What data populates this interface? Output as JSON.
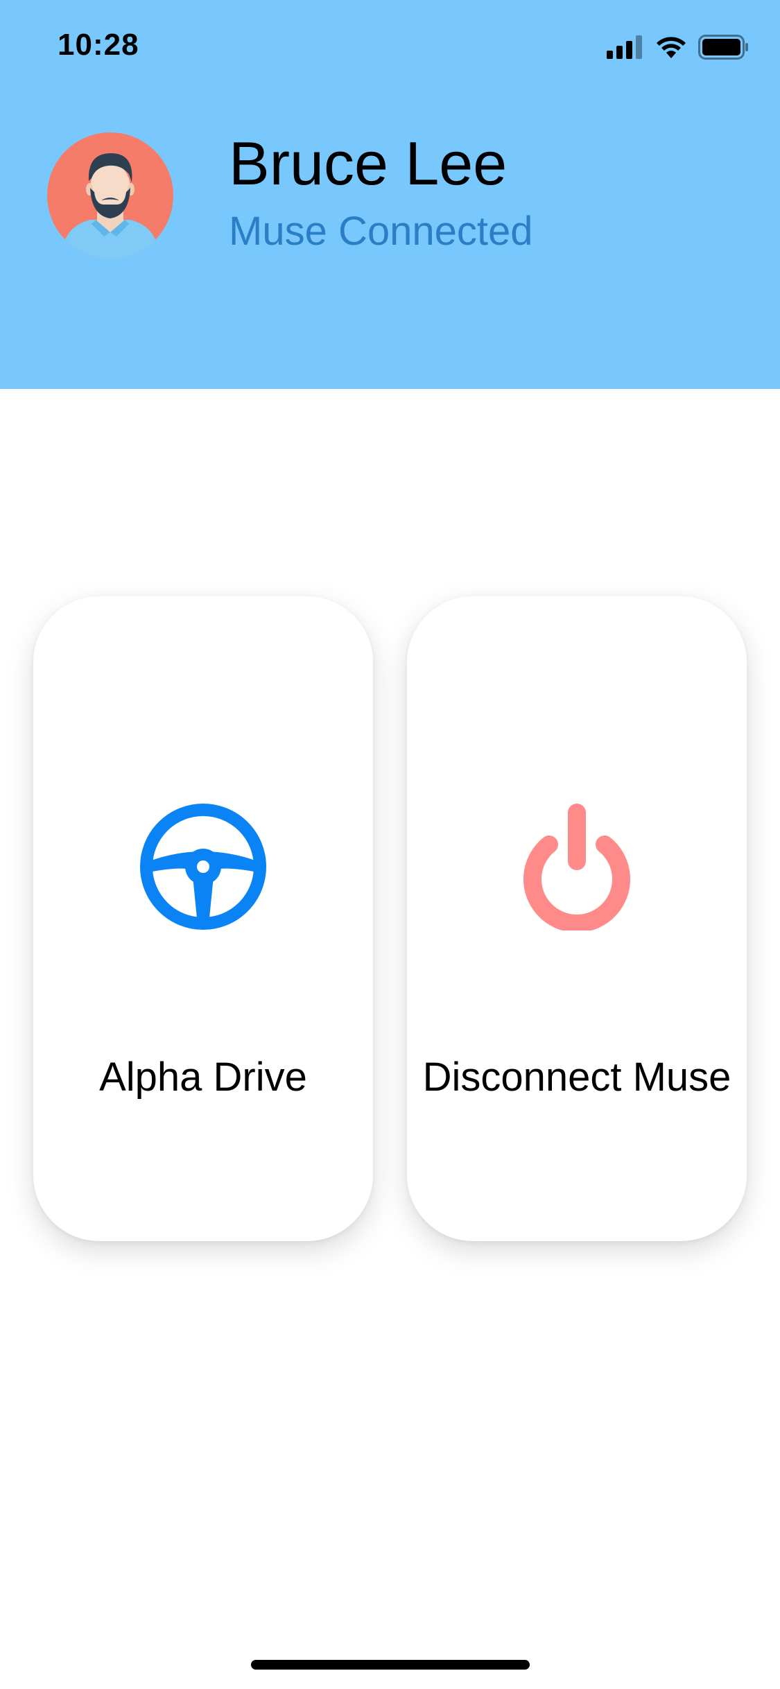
{
  "status_bar": {
    "time": "10:28",
    "icons": [
      "cellular-signal-icon",
      "wifi-icon",
      "battery-icon"
    ]
  },
  "profile": {
    "name": "Bruce Lee",
    "status": "Muse Connected",
    "avatar": "bearded-man-avatar"
  },
  "actions": [
    {
      "label": "Alpha Drive",
      "icon": "steering-wheel-icon",
      "color": "#0A84F5"
    },
    {
      "label": "Disconnect Muse",
      "icon": "power-icon",
      "color": "#FF8A8A"
    }
  ],
  "colors": {
    "header_bg": "#79C8FD",
    "status_text": "#2A7EC5",
    "avatar_bg": "#F47C68"
  }
}
